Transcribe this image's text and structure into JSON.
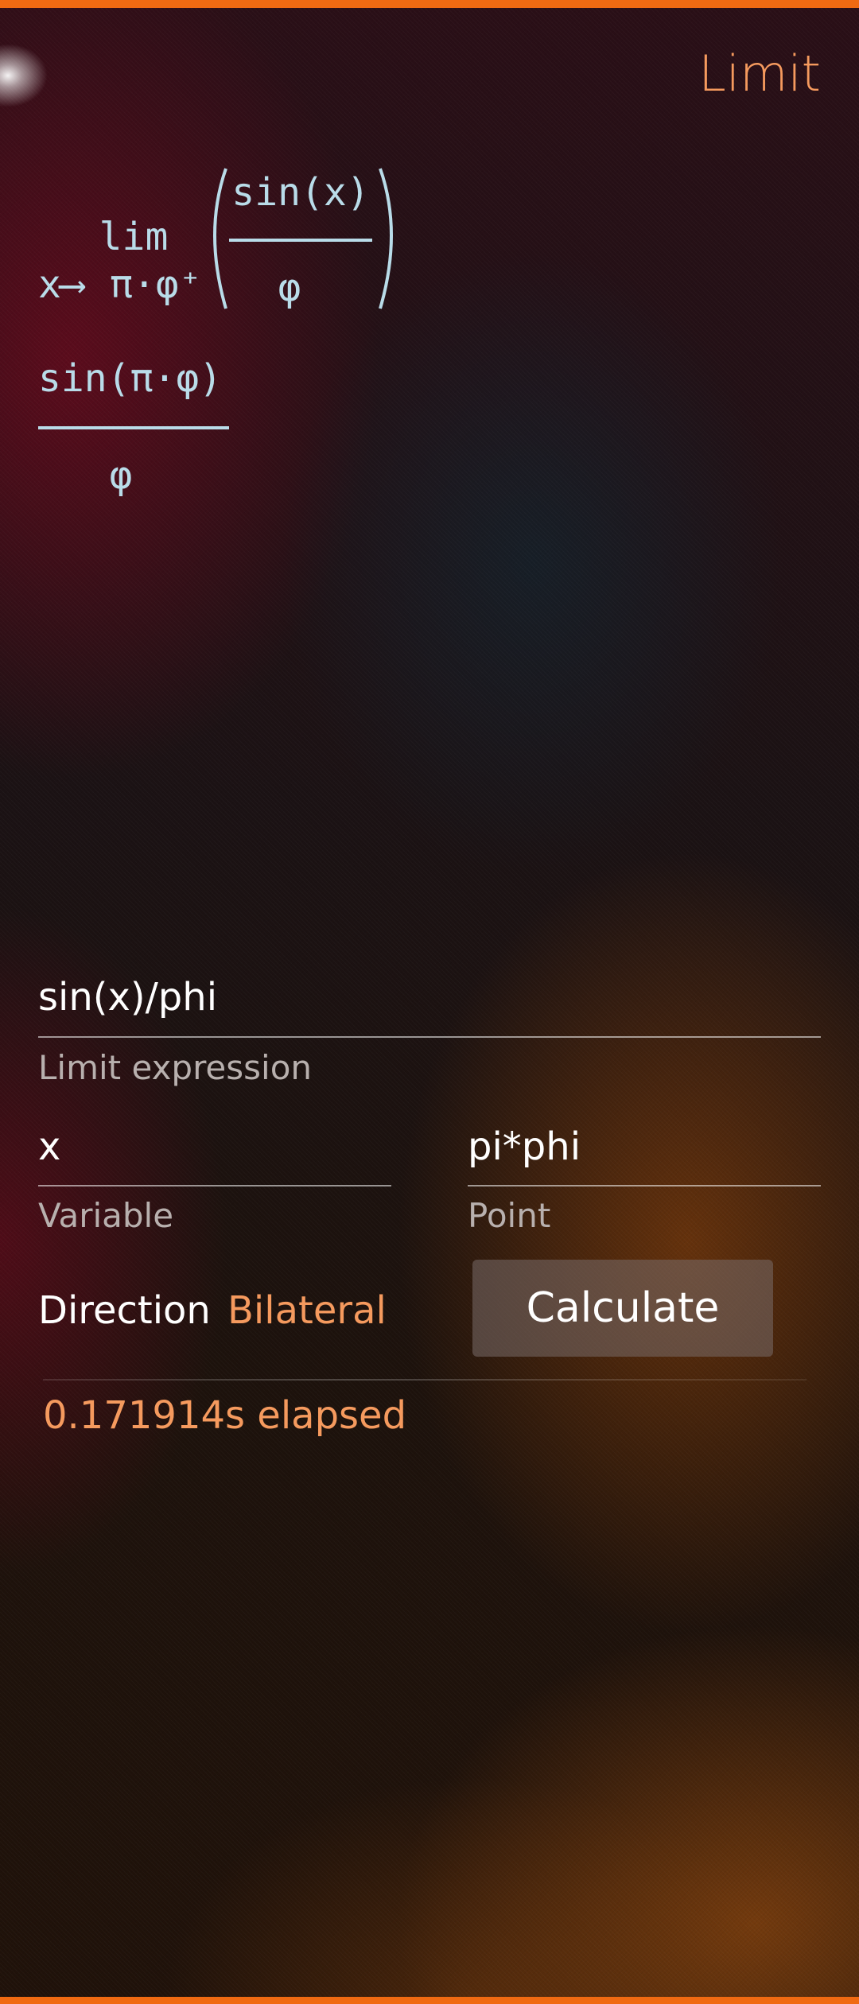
{
  "page": {
    "title": "Limit"
  },
  "formula": {
    "lim_label": "lim",
    "approach_variable": "x",
    "approach_arrow": "⟶",
    "approach_point": "π·φ⁺",
    "numerator": "sin(x)",
    "denominator": "φ"
  },
  "result": {
    "numerator": "sin(π·φ)",
    "denominator": "φ"
  },
  "form": {
    "expression": {
      "value": "sin(x)/phi",
      "label": "Limit expression"
    },
    "variable": {
      "value": "x",
      "label": "Variable"
    },
    "point": {
      "value": "pi*phi",
      "label": "Point"
    },
    "direction": {
      "label": "Direction",
      "value": "Bilateral"
    },
    "calculate_label": "Calculate"
  },
  "status": {
    "elapsed": "0.171914s elapsed"
  },
  "colors": {
    "accent": "#f06a12",
    "highlight_text": "#f59a5e",
    "formula_text": "#b9dce9"
  }
}
